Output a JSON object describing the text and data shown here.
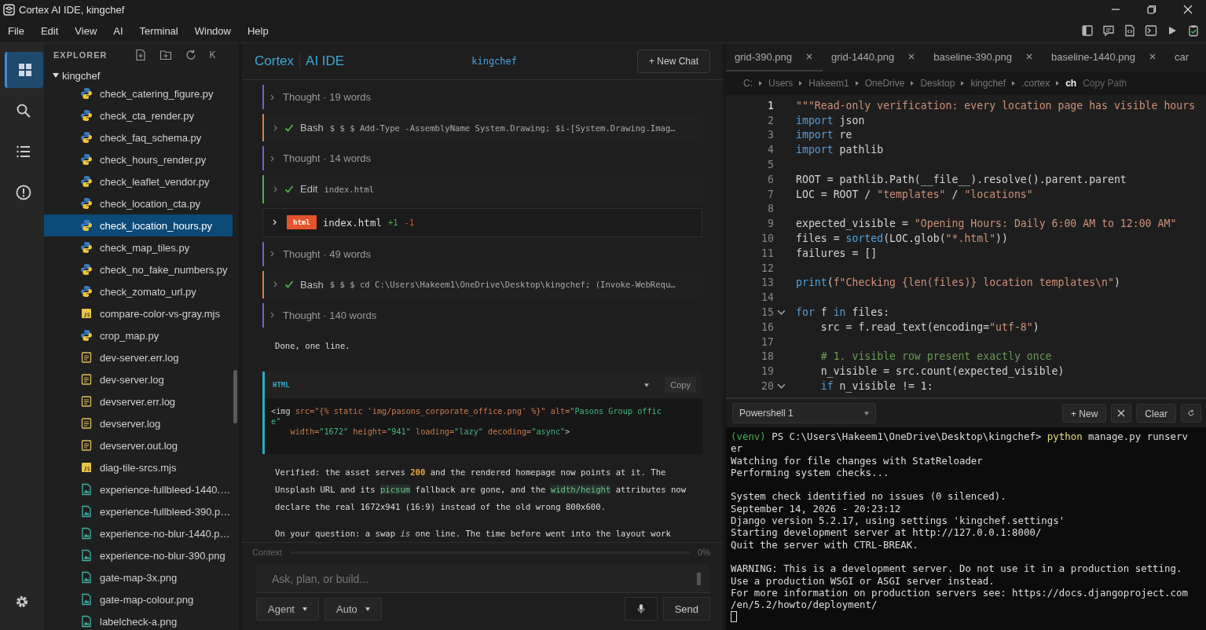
{
  "window": {
    "title": "Cortex AI IDE, kingchef"
  },
  "menu": [
    "File",
    "Edit",
    "View",
    "AI",
    "Terminal",
    "Window",
    "Help"
  ],
  "toolbar": [
    {
      "kind": "sidebar"
    },
    {
      "kind": "chat"
    },
    {
      "kind": "file"
    },
    {
      "kind": "terminal"
    },
    {
      "kind": "run"
    },
    {
      "kind": "clipboard"
    }
  ],
  "activity": [
    {
      "kind": "explorer",
      "selected": true
    },
    {
      "kind": "search",
      "selected": false
    },
    {
      "kind": "list",
      "selected": false
    },
    {
      "kind": "problems",
      "selected": false
    }
  ],
  "explorer": {
    "title": "EXPLORER",
    "collapse": "K",
    "root": {
      "name": "kingchef",
      "expanded": true,
      "children": [
        {
          "name": "check_catering_figure.py",
          "kind": "py",
          "selected": false
        },
        {
          "name": "check_cta_render.py",
          "kind": "py",
          "selected": false
        },
        {
          "name": "check_faq_schema.py",
          "kind": "py",
          "selected": false
        },
        {
          "name": "check_hours_render.py",
          "kind": "py",
          "selected": false
        },
        {
          "name": "check_leaflet_vendor.py",
          "kind": "py",
          "selected": false
        },
        {
          "name": "check_location_cta.py",
          "kind": "py",
          "selected": false
        },
        {
          "name": "check_location_hours.py",
          "kind": "py",
          "selected": true
        },
        {
          "name": "check_map_tiles.py",
          "kind": "py",
          "selected": false
        },
        {
          "name": "check_no_fake_numbers.py",
          "kind": "py",
          "selected": false
        },
        {
          "name": "check_zomato_url.py",
          "kind": "py",
          "selected": false
        },
        {
          "name": "compare-color-vs-gray.mjs",
          "kind": "js",
          "selected": false
        },
        {
          "name": "crop_map.py",
          "kind": "py",
          "selected": false
        },
        {
          "name": "dev-server.err.log",
          "kind": "log",
          "selected": false
        },
        {
          "name": "dev-server.log",
          "kind": "log",
          "selected": false
        },
        {
          "name": "devserver.err.log",
          "kind": "log",
          "selected": false
        },
        {
          "name": "devserver.log",
          "kind": "log",
          "selected": false
        },
        {
          "name": "devserver.out.log",
          "kind": "log",
          "selected": false
        },
        {
          "name": "diag-tile-srcs.mjs",
          "kind": "js",
          "selected": false
        },
        {
          "name": "experience-fullbleed-1440.…",
          "kind": "png",
          "selected": false
        },
        {
          "name": "experience-fullbleed-390.p…",
          "kind": "png",
          "selected": false
        },
        {
          "name": "experience-no-blur-1440.p…",
          "kind": "png",
          "selected": false
        },
        {
          "name": "experience-no-blur-390.png",
          "kind": "png",
          "selected": false
        },
        {
          "name": "gate-map-3x.png",
          "kind": "png",
          "selected": false
        },
        {
          "name": "gate-map-colour.png",
          "kind": "png",
          "selected": false
        },
        {
          "name": "labelcheck-a.png",
          "kind": "png",
          "selected": false
        }
      ]
    }
  },
  "chat": {
    "brand": "Cortex",
    "product": "AI IDE",
    "project": "kingchef",
    "new_chat": "+ New Chat",
    "messages": [
      {
        "kind": "thought",
        "label": "Thought · 19 words"
      },
      {
        "kind": "tool",
        "name": "Bash",
        "command": "$ $ $ Add-Type -AssemblyName System.Drawing; $i-[System.Drawing.Imag…",
        "color": "#e0823d"
      },
      {
        "kind": "thought",
        "label": "Thought · 14 words"
      },
      {
        "kind": "tool",
        "name": "Edit",
        "command": "index.html",
        "color": "#4caf50"
      },
      {
        "kind": "diff",
        "badge": "html",
        "file": "index.html",
        "added": "+1",
        "removed": "-1"
      },
      {
        "kind": "thought",
        "label": "Thought · 49 words"
      },
      {
        "kind": "tool",
        "name": "Bash",
        "command": "$ $ $ cd C:\\Users\\Hakeem1\\OneDrive\\Desktop\\kingchef; (Invoke-WebRequ…",
        "color": "#e0823d"
      },
      {
        "kind": "thought",
        "label": "Thought · 140 words"
      },
      {
        "kind": "text",
        "segments": [
          {
            "kind": "plain",
            "text": "Done, one line."
          }
        ]
      },
      {
        "kind": "code",
        "language": "HTML",
        "copy": "Copy",
        "lines": [
          [
            {
              "kind": "tag",
              "text": "<img "
            },
            {
              "kind": "attr",
              "text": "src=\"{% static 'img/pasons_corporate_office.png' %}\" alt="
            },
            {
              "kind": "value",
              "text": "\"Pasons Group offic"
            }
          ],
          [
            {
              "kind": "value",
              "text": "e\""
            }
          ],
          [
            {
              "kind": "attr",
              "text": "    width="
            },
            {
              "kind": "value",
              "text": "\"1672\" "
            },
            {
              "kind": "attr",
              "text": "height="
            },
            {
              "kind": "value",
              "text": "\"941\" "
            },
            {
              "kind": "attr",
              "text": "loading="
            },
            {
              "kind": "value",
              "text": "\"lazy\" "
            },
            {
              "kind": "attr",
              "text": "decoding="
            },
            {
              "kind": "value",
              "text": "\"async\""
            },
            {
              "kind": "tag",
              "text": ">"
            }
          ]
        ]
      },
      {
        "kind": "text",
        "segments": [
          {
            "kind": "plain",
            "text": "Verified: the asset serves "
          },
          {
            "kind": "num",
            "text": "200"
          },
          {
            "kind": "plain",
            "text": " and the rendered homepage now points at it. The Unsplash URL and its "
          },
          {
            "kind": "code",
            "text": "picsum"
          },
          {
            "kind": "plain",
            "text": " fallback are gone, and the "
          },
          {
            "kind": "code",
            "text": "width/height"
          },
          {
            "kind": "plain",
            "text": " attributes now declare the real 1672x941 (16:9) instead of the old wrong 800x600."
          }
        ]
      },
      {
        "kind": "text",
        "segments": [
          {
            "kind": "plain",
            "text": "On your question: a swap "
          },
          {
            "kind": "em",
            "text": "is"
          },
          {
            "kind": "plain",
            "text": " one line. The time before went into the layout work"
          }
        ]
      }
    ],
    "context": {
      "label": "Context",
      "level": 0,
      "reading": "0%"
    },
    "input": {
      "placeholder": "Ask, plan, or build..."
    },
    "mode": "Agent",
    "model": "Auto",
    "send": "Send"
  },
  "editor": {
    "tabs": [
      {
        "label": "grid-390.png",
        "selected": true
      },
      {
        "label": "grid-1440.png",
        "selected": false
      },
      {
        "label": "baseline-390.png",
        "selected": false
      },
      {
        "label": "baseline-1440.png",
        "selected": false
      },
      {
        "label": "car",
        "selected": false
      }
    ],
    "breadcrumb": [
      "C:",
      "Users",
      "Hakeem1",
      "OneDrive",
      "Desktop",
      "kingchef",
      ".cortex",
      "ch"
    ],
    "copy_path": "Copy Path",
    "lines": [
      {
        "number": "1",
        "current": true,
        "fold": false,
        "tokens": [
          {
            "kind": "str",
            "text": "\"\"\"Read-only verification: every location page has visible hours"
          }
        ]
      },
      {
        "number": "2",
        "current": false,
        "fold": false,
        "tokens": [
          {
            "kind": "kw",
            "text": "import"
          },
          {
            "kind": "pl",
            "text": " json"
          }
        ]
      },
      {
        "number": "3",
        "current": false,
        "fold": false,
        "tokens": [
          {
            "kind": "kw",
            "text": "import"
          },
          {
            "kind": "pl",
            "text": " re"
          }
        ]
      },
      {
        "number": "4",
        "current": false,
        "fold": false,
        "tokens": [
          {
            "kind": "kw",
            "text": "import"
          },
          {
            "kind": "pl",
            "text": " pathlib"
          }
        ]
      },
      {
        "number": "5",
        "current": false,
        "fold": false
      },
      {
        "number": "6",
        "current": false,
        "fold": false,
        "tokens": [
          {
            "kind": "pl",
            "text": "ROOT = pathlib.Path(__file__).resolve().parent.parent"
          }
        ]
      },
      {
        "number": "7",
        "current": false,
        "fold": false,
        "tokens": [
          {
            "kind": "pl",
            "text": "LOC = ROOT / "
          },
          {
            "kind": "str",
            "text": "\"templates\""
          },
          {
            "kind": "pl",
            "text": " / "
          },
          {
            "kind": "str",
            "text": "\"locations\""
          }
        ]
      },
      {
        "number": "8",
        "current": false,
        "fold": false
      },
      {
        "number": "9",
        "current": false,
        "fold": false,
        "tokens": [
          {
            "kind": "pl",
            "text": "expected_visible = "
          },
          {
            "kind": "str",
            "text": "\"Opening Hours: Daily 6:00 AM to 12:00 AM\""
          }
        ]
      },
      {
        "number": "10",
        "current": false,
        "fold": false,
        "tokens": [
          {
            "kind": "pl",
            "text": "files = "
          },
          {
            "kind": "fn",
            "text": "sorted"
          },
          {
            "kind": "pl",
            "text": "(LOC.glob("
          },
          {
            "kind": "str",
            "text": "\"*.html\""
          },
          {
            "kind": "pl",
            "text": "))"
          }
        ]
      },
      {
        "number": "11",
        "current": false,
        "fold": false,
        "tokens": [
          {
            "kind": "pl",
            "text": "failures = []"
          }
        ]
      },
      {
        "number": "12",
        "current": false,
        "fold": false
      },
      {
        "number": "13",
        "current": false,
        "fold": false,
        "tokens": [
          {
            "kind": "fn",
            "text": "print"
          },
          {
            "kind": "pl",
            "text": "("
          },
          {
            "kind": "str",
            "text": "f\"Checking {len(files)} location templates\\n\""
          },
          {
            "kind": "pl",
            "text": ")"
          }
        ]
      },
      {
        "number": "14",
        "current": false,
        "fold": false
      },
      {
        "number": "15",
        "current": false,
        "fold": true,
        "tokens": [
          {
            "kind": "kw",
            "text": "for"
          },
          {
            "kind": "pl",
            "text": " f "
          },
          {
            "kind": "kw",
            "text": "in"
          },
          {
            "kind": "pl",
            "text": " files:"
          }
        ]
      },
      {
        "number": "16",
        "current": false,
        "fold": false,
        "tokens": [
          {
            "kind": "pl",
            "text": "    src = f.read_text(encoding="
          },
          {
            "kind": "str",
            "text": "\"utf-8\""
          },
          {
            "kind": "pl",
            "text": ")"
          }
        ]
      },
      {
        "number": "17",
        "current": false,
        "fold": false
      },
      {
        "number": "18",
        "current": false,
        "fold": false,
        "tokens": [
          {
            "kind": "cm",
            "text": "    # 1. visible row present exactly once"
          }
        ]
      },
      {
        "number": "19",
        "current": false,
        "fold": false,
        "tokens": [
          {
            "kind": "pl",
            "text": "    n_visible = src.count(expected_visible)"
          }
        ]
      },
      {
        "number": "20",
        "current": false,
        "fold": true,
        "tokens": [
          {
            "kind": "kw",
            "text": "    if"
          },
          {
            "kind": "pl",
            "text": " n_visible != 1:"
          }
        ]
      }
    ]
  },
  "terminal": {
    "shell": "Powershell 1",
    "new": "+ New",
    "clear": "Clear",
    "lines": [
      {
        "kind": "output",
        "segments": [
          {
            "kind": "venv",
            "text": "(venv)"
          },
          {
            "kind": "pl",
            "text": " PS C:\\Users\\Hakeem1\\OneDrive\\Desktop\\kingchef> "
          },
          {
            "kind": "cmd",
            "text": "python"
          },
          {
            "kind": "pl",
            "text": " manage.py runserv"
          }
        ]
      },
      {
        "kind": "output",
        "segments": [
          {
            "kind": "pl",
            "text": "er"
          }
        ]
      },
      {
        "kind": "output",
        "segments": [
          {
            "kind": "pl",
            "text": "Watching for file changes with StatReloader"
          }
        ]
      },
      {
        "kind": "output",
        "segments": [
          {
            "kind": "pl",
            "text": "Performing system checks..."
          }
        ]
      },
      {
        "kind": "blank"
      },
      {
        "kind": "output",
        "segments": [
          {
            "kind": "pl",
            "text": "System check identified no issues (0 silenced)."
          }
        ]
      },
      {
        "kind": "output",
        "segments": [
          {
            "kind": "pl",
            "text": "September 14, 2026 - 20:23:12"
          }
        ]
      },
      {
        "kind": "output",
        "segments": [
          {
            "kind": "pl",
            "text": "Django version 5.2.17, using settings 'kingchef.settings'"
          }
        ]
      },
      {
        "kind": "output",
        "segments": [
          {
            "kind": "pl",
            "text": "Starting development server at http://127.0.0.1:8000/"
          }
        ]
      },
      {
        "kind": "output",
        "segments": [
          {
            "kind": "pl",
            "text": "Quit the server with CTRL-BREAK."
          }
        ]
      },
      {
        "kind": "blank"
      },
      {
        "kind": "output",
        "segments": [
          {
            "kind": "pl",
            "text": "WARNING: This is a development server. Do not use it in a production setting."
          }
        ]
      },
      {
        "kind": "output",
        "segments": [
          {
            "kind": "pl",
            "text": "Use a production WSGI or ASGI server instead."
          }
        ]
      },
      {
        "kind": "output",
        "segments": [
          {
            "kind": "pl",
            "text": "For more information on production servers see: https://docs.djangoproject.com"
          }
        ]
      },
      {
        "kind": "output",
        "segments": [
          {
            "kind": "pl",
            "text": "/en/5.2/howto/deployment/"
          }
        ]
      }
    ]
  }
}
